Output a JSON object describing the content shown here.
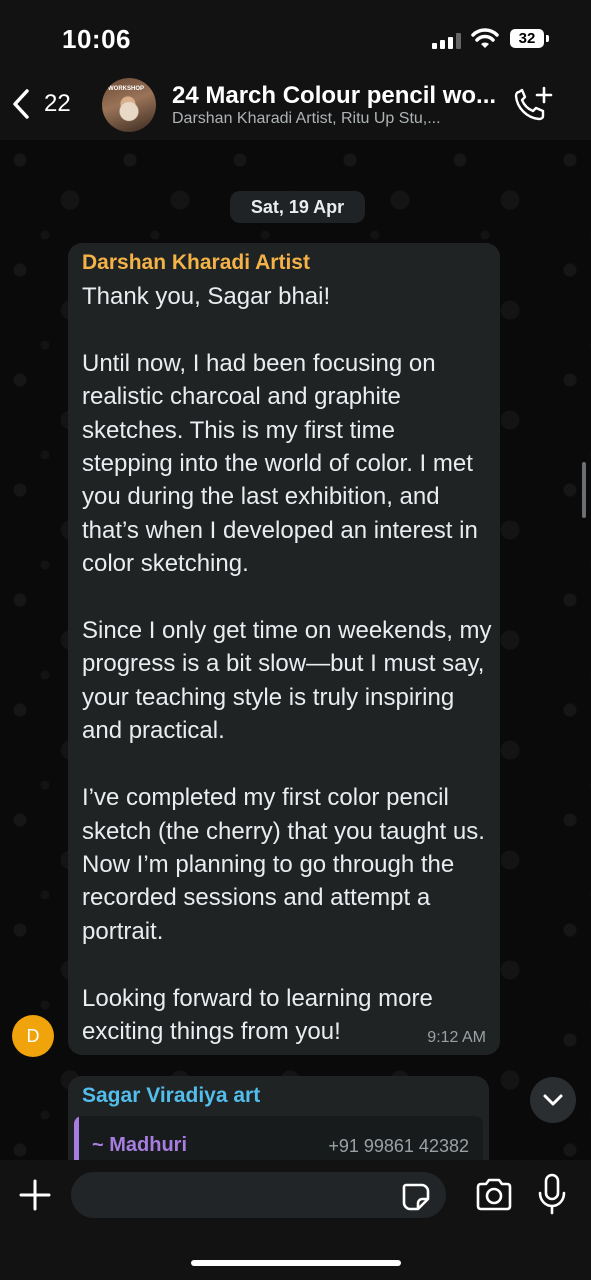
{
  "status_bar": {
    "time": "10:06",
    "battery": "32"
  },
  "header": {
    "back_count": "22",
    "avatar_text": "WORKSHOP",
    "title": "24 March Colour pencil wo...",
    "subtitle": "Darshan Kharadi Artist, Ritu Up Stu,..."
  },
  "date_divider": "Sat, 19 Apr",
  "message": {
    "sender": "Darshan Kharadi Artist",
    "sender_color": "#f4b247",
    "avatar_initial": "D",
    "avatar_color": "#f0a30a",
    "text": "Thank you, Sagar bhai!\n\nUntil now, I had been focusing on realistic charcoal and graphite sketches. This is my first time stepping into the world of color. I met you during the last exhibition, and that’s when I developed an interest in color sketching.\n\nSince I only get time on weekends, my progress is a bit slow—but I must say, your teaching style is truly inspiring and practical.\n\nI’ve completed my first color pencil sketch (the cherry) that you taught us. Now I’m planning to go through the recorded sessions and attempt a portrait.\n\nLooking forward to learning more exciting things from you!",
    "time": "9:12 AM"
  },
  "reply_message": {
    "sender": "Sagar Viradiya art",
    "sender_color": "#53bdeb",
    "quoted_name": "~ Madhuri",
    "quoted_phone": "+91 99861 42382"
  },
  "icons": {
    "back": "chevron-left-icon",
    "add_call": "phone-plus-icon",
    "scroll_down": "chevron-down-icon",
    "attach": "plus-icon",
    "sticker": "sticker-icon",
    "camera": "camera-icon",
    "mic": "microphone-icon"
  },
  "input": {
    "value": "",
    "placeholder": ""
  }
}
